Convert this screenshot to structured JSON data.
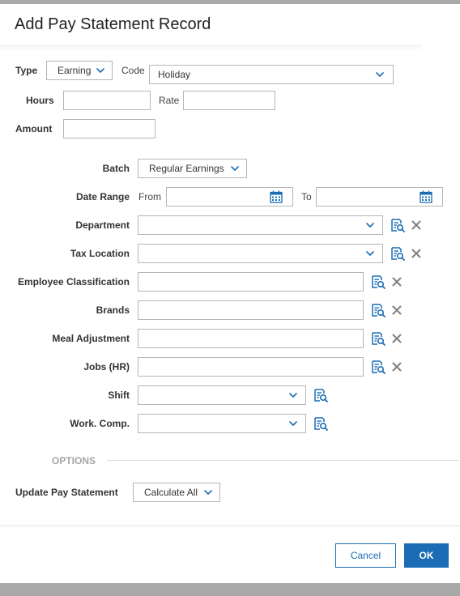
{
  "dialog": {
    "title": "Add Pay Statement Record",
    "type_label": "Type",
    "type_value": "Earning",
    "code_label": "Code",
    "code_value": "Holiday",
    "hours_label": "Hours",
    "hours_value": "",
    "rate_label": "Rate",
    "rate_value": "",
    "amount_label": "Amount",
    "amount_value": "",
    "batch_label": "Batch",
    "batch_value": "Regular Earnings",
    "date_range_label": "Date Range",
    "from_label": "From",
    "from_value": "",
    "to_label": "To",
    "to_value": "",
    "department_label": "Department",
    "department_value": "",
    "tax_location_label": "Tax Location",
    "tax_location_value": "",
    "employee_classification_label": "Employee Classification",
    "employee_classification_value": "",
    "brands_label": "Brands",
    "brands_value": "",
    "meal_adjustment_label": "Meal Adjustment",
    "meal_adjustment_value": "",
    "jobs_label": "Jobs (HR)",
    "jobs_value": "",
    "shift_label": "Shift",
    "shift_value": "",
    "work_comp_label": "Work. Comp.",
    "work_comp_value": "",
    "options_label": "OPTIONS",
    "update_pay_statement_label": "Update Pay Statement",
    "update_pay_statement_value": "Calculate All",
    "cancel_label": "Cancel",
    "ok_label": "OK"
  },
  "icons": {
    "dropdown": "chevron-down-icon",
    "lookup": "lookup-list-search-icon",
    "clear": "close-icon",
    "calendar": "calendar-icon"
  },
  "colors": {
    "accent": "#1a6db5",
    "overlay": "#a9a9a9",
    "clear_icon": "#808080",
    "options_label": "#a5a5a5"
  }
}
